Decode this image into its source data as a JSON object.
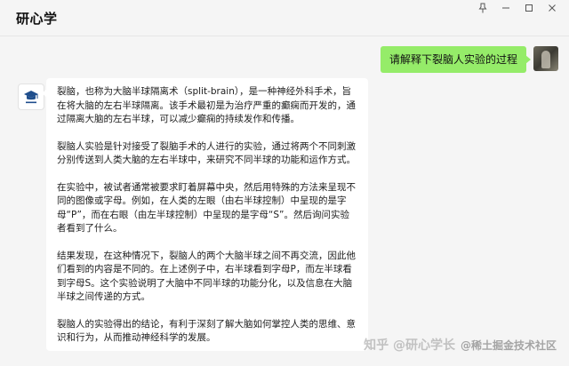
{
  "window": {
    "title": "研心学",
    "controls": [
      "pin-icon",
      "minimize-icon",
      "maximize-icon",
      "close-icon"
    ]
  },
  "conversation": {
    "user_message": "请解释下裂脑人实验的过程",
    "bot_paragraphs": [
      "裂脑，也称为大脑半球隔离术（split-brain），是一种神经外科手术，旨在将大脑的左右半球隔离。该手术最初是为治疗严重的癫痫而开发的，通过隔离大脑的左右半球，可以减少癫痫的持续发作和传播。",
      "裂脑人实验是针对接受了裂脑手术的人进行的实验，通过将两个不同刺激分别传送到人类大脑的左右半球中，来研究不同半球的功能和运作方式。",
      "在实验中，被试者通常被要求盯着屏幕中央，然后用特殊的方法来呈现不同的图像或字母。例如，在人类的左眼（由右半球控制）中呈现的是字母“P”，而在右眼（由左半球控制）中呈现的是字母“S”。然后询问实验者看到了什么。",
      "结果发现，在这种情况下，裂脑人的两个大脑半球之间不再交流，因此他们看到的内容是不同的。在上述例子中，右半球看到字母P，而左半球看到字母S。这个实验说明了大脑中不同半球的功能分化，以及信息在大脑半球之间传递的方式。",
      "裂脑人的实验得出的结论，有利于深刻了解大脑如何掌控人类的思维、意识和行为，从而推动神经科学的发展。"
    ]
  },
  "watermark": {
    "main": "知乎 @研心学长",
    "sub": "@稀土掘金技术社区"
  },
  "colors": {
    "background": "#f5f5f5",
    "user_bubble": "#95ec69",
    "bot_bubble": "#ffffff",
    "bot_logo": "#1f4e8c"
  }
}
